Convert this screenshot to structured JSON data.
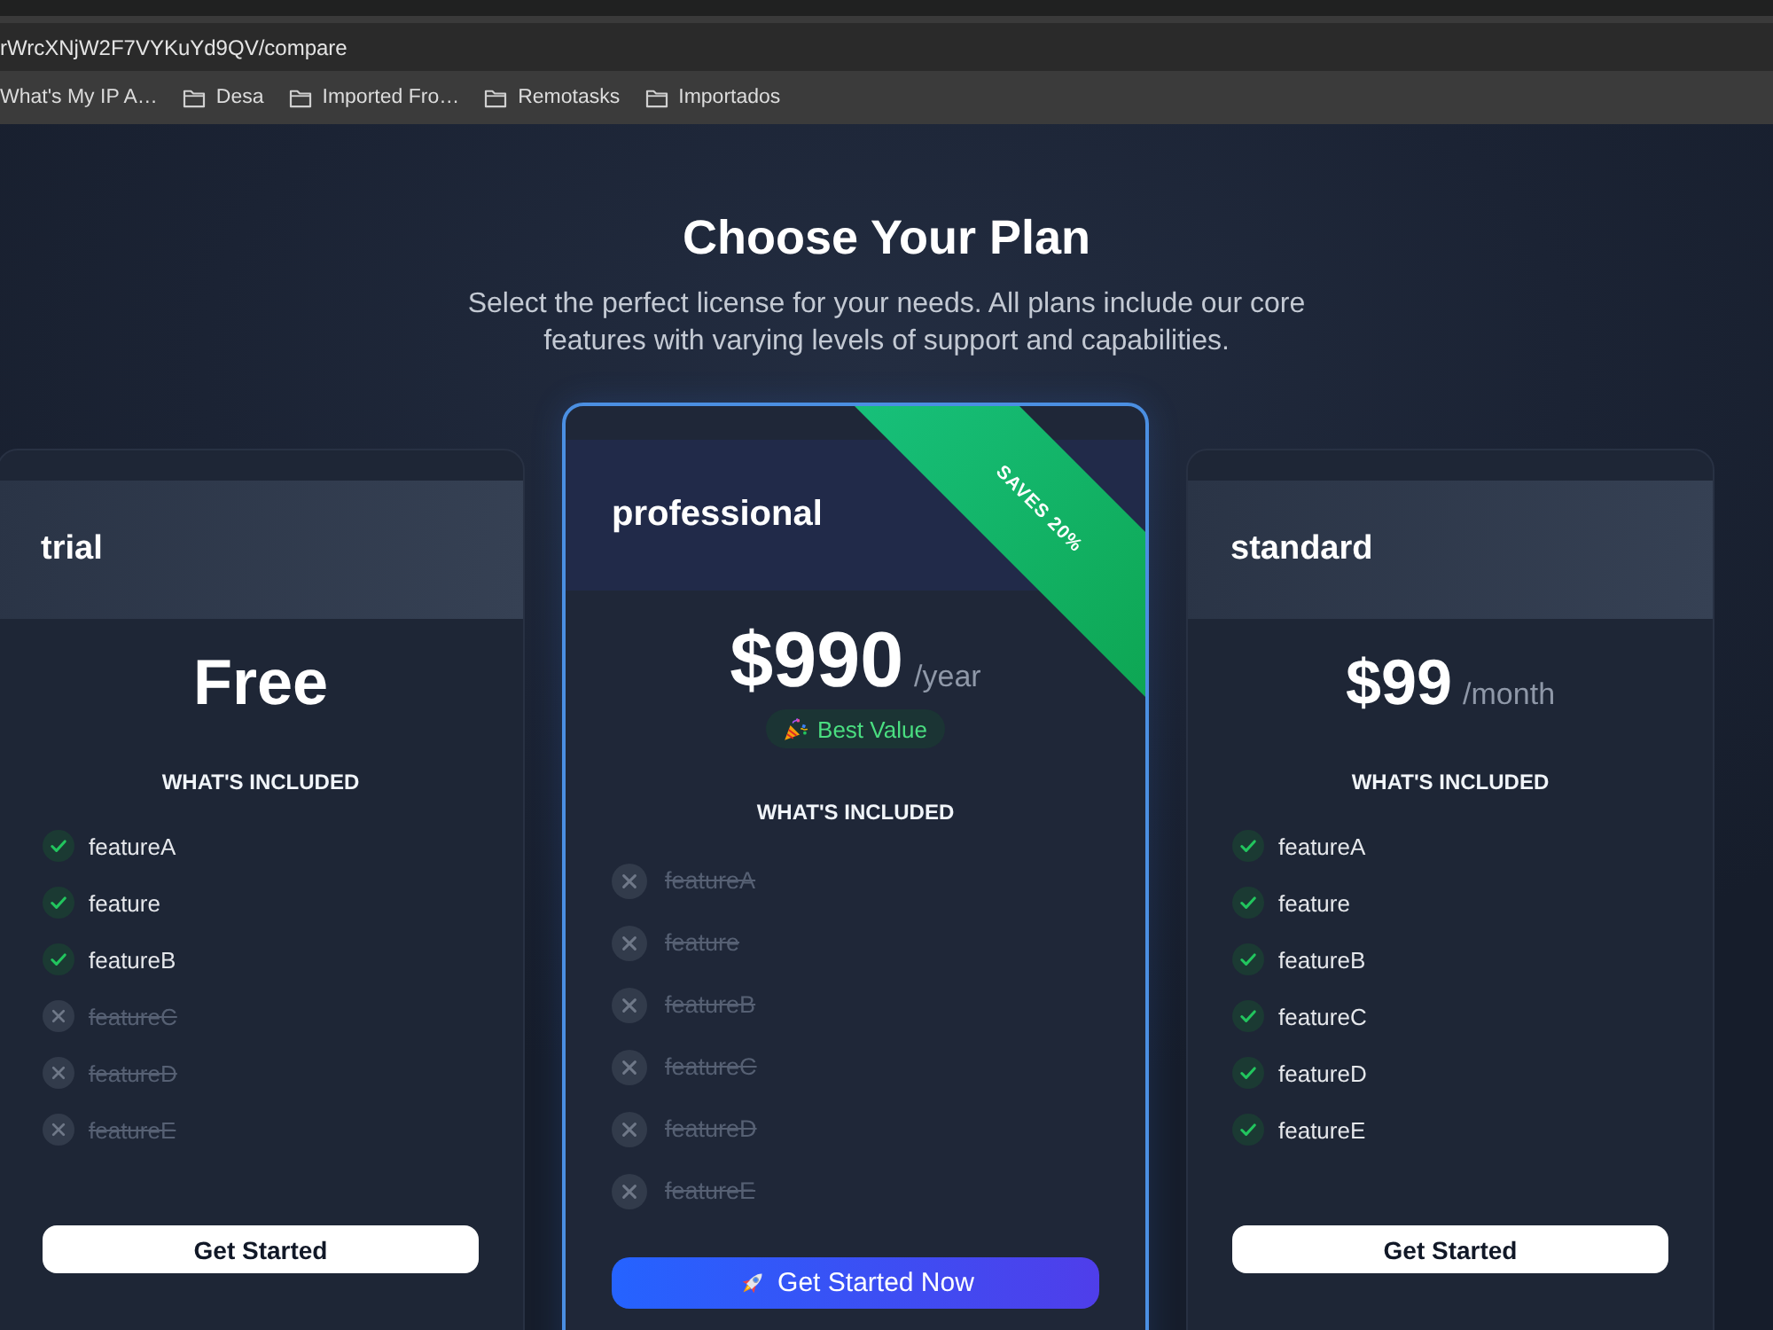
{
  "browser": {
    "url": "rWrcXNjW2F7VYKuYd9QV/compare",
    "bookmarks": [
      {
        "label": "What's My IP A…",
        "kind": "link"
      },
      {
        "label": "Desa",
        "kind": "folder"
      },
      {
        "label": "Imported Fro…",
        "kind": "folder"
      },
      {
        "label": "Remotasks",
        "kind": "folder"
      },
      {
        "label": "Importados",
        "kind": "folder"
      }
    ]
  },
  "header": {
    "title": "Choose Your Plan",
    "subtitle": "Select the perfect license for your needs. All plans include our core features with varying levels of support and capabilities."
  },
  "plans": [
    {
      "name": "trial",
      "featured": false,
      "price": "Free",
      "included_heading": "WHAT'S INCLUDED",
      "features": [
        {
          "label": "featureA",
          "included": true
        },
        {
          "label": "feature",
          "included": true
        },
        {
          "label": "featureB",
          "included": true
        },
        {
          "label": "featureC",
          "included": false
        },
        {
          "label": "featureD",
          "included": false
        },
        {
          "label": "featureE",
          "included": false
        }
      ],
      "button": "Get Started"
    },
    {
      "name": "professional",
      "featured": true,
      "ribbon": "SAVES 20%",
      "price": "$990",
      "period": "/year",
      "badge": "Best Value",
      "included_heading": "WHAT'S INCLUDED",
      "features": [
        {
          "label": "featureA",
          "included": false
        },
        {
          "label": "feature",
          "included": false
        },
        {
          "label": "featureB",
          "included": false
        },
        {
          "label": "featureC",
          "included": false
        },
        {
          "label": "featureD",
          "included": false
        },
        {
          "label": "featureE",
          "included": false
        }
      ],
      "button": "Get Started Now"
    },
    {
      "name": "standard",
      "featured": false,
      "price": "$99",
      "period": "/month",
      "included_heading": "WHAT'S INCLUDED",
      "features": [
        {
          "label": "featureA",
          "included": true
        },
        {
          "label": "feature",
          "included": true
        },
        {
          "label": "featureB",
          "included": true
        },
        {
          "label": "featureC",
          "included": true
        },
        {
          "label": "featureD",
          "included": true
        },
        {
          "label": "featureE",
          "included": true
        }
      ],
      "button": "Get Started"
    }
  ]
}
